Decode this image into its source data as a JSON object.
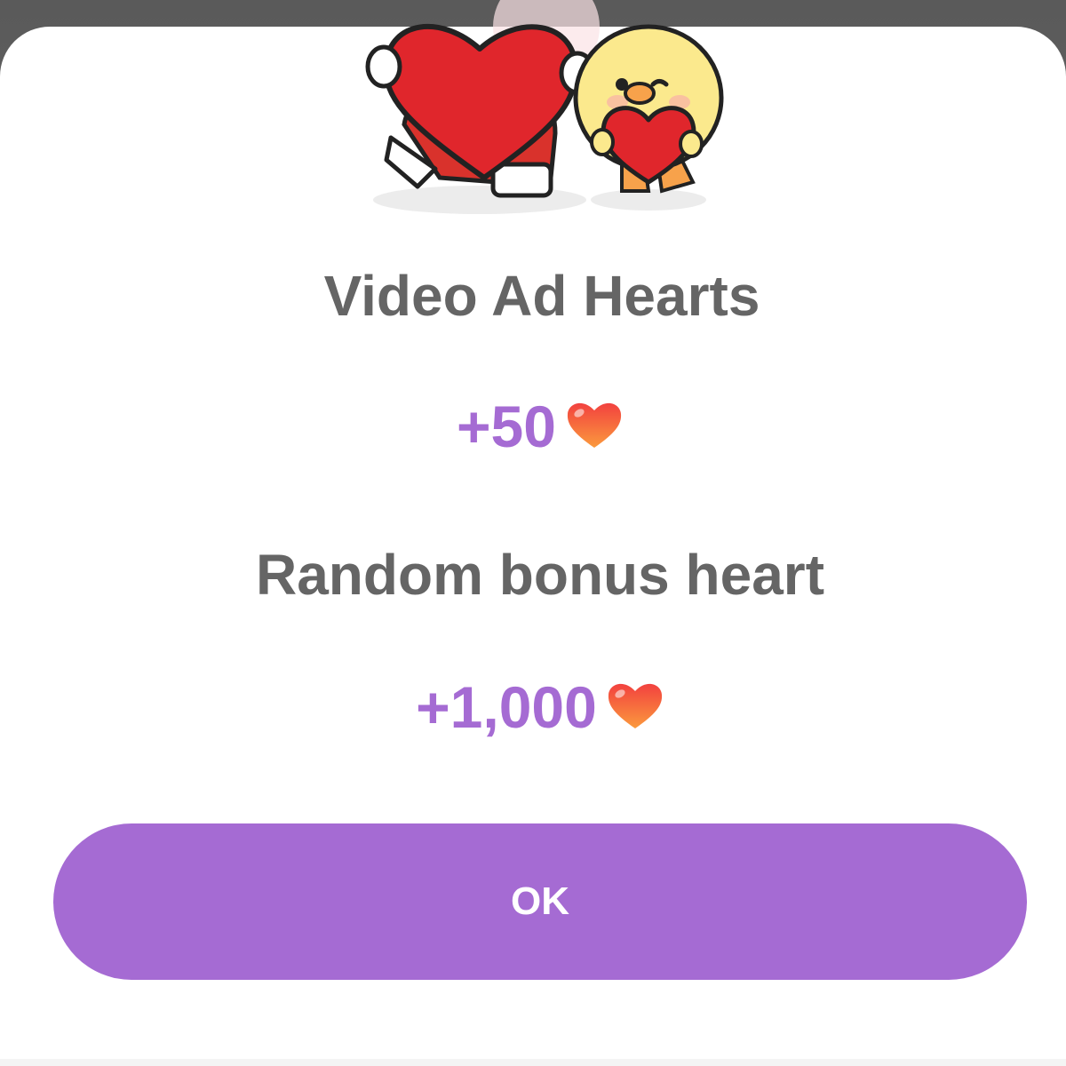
{
  "dialog": {
    "illustration_icon": "heart-hugging-characters",
    "rewards": [
      {
        "title": "Video Ad Hearts",
        "amount": "+50",
        "icon": "heart-icon"
      },
      {
        "title": "Random bonus heart",
        "amount": "+1,000",
        "icon": "heart-icon"
      }
    ],
    "ok_label": "OK"
  },
  "colors": {
    "accent": "#a56bd3",
    "title_text": "#656565",
    "heart": "#f05a3c"
  }
}
